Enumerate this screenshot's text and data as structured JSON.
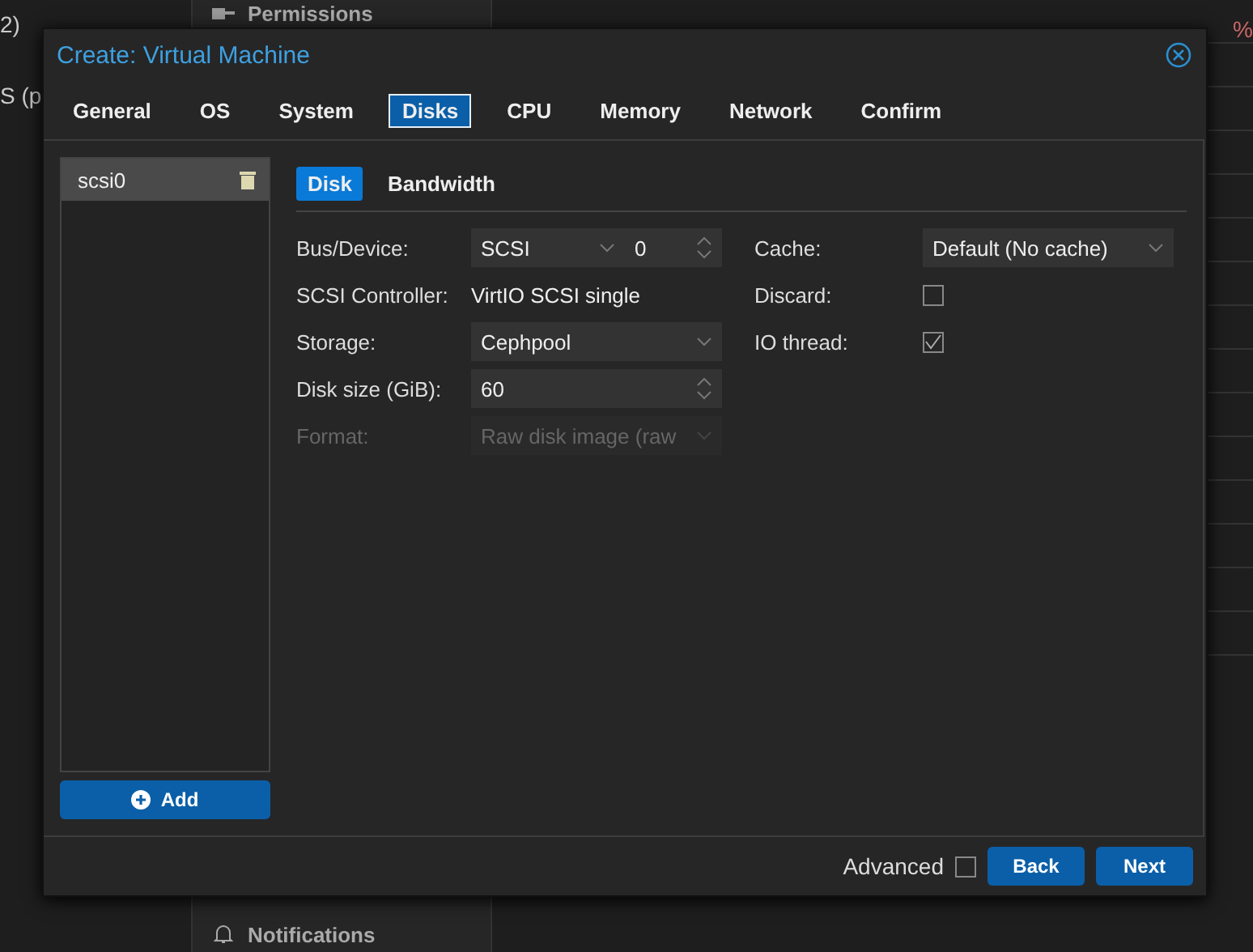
{
  "background": {
    "left_texts": [
      "2)",
      "S (p"
    ],
    "sidebar_items": [
      {
        "label": "Permissions"
      },
      {
        "label": "Notifications"
      }
    ],
    "edge_text": "%"
  },
  "dialog": {
    "title": "Create: Virtual Machine",
    "tabs": [
      {
        "label": "General",
        "selected": false
      },
      {
        "label": "OS",
        "selected": false
      },
      {
        "label": "System",
        "selected": false
      },
      {
        "label": "Disks",
        "selected": true
      },
      {
        "label": "CPU",
        "selected": false
      },
      {
        "label": "Memory",
        "selected": false
      },
      {
        "label": "Network",
        "selected": false
      },
      {
        "label": "Confirm",
        "selected": false
      }
    ],
    "disk_list": [
      {
        "label": "scsi0",
        "selected": true
      }
    ],
    "add_button": "Add",
    "subtabs": [
      {
        "label": "Disk",
        "selected": true
      },
      {
        "label": "Bandwidth",
        "selected": false
      }
    ],
    "left_fields": [
      {
        "label": "Bus/Device:",
        "kind": "bus",
        "value": "SCSI",
        "number": "0",
        "disabled": false
      },
      {
        "label": "SCSI Controller:",
        "kind": "text",
        "value": "VirtIO SCSI single",
        "disabled": false
      },
      {
        "label": "Storage:",
        "kind": "select",
        "value": "Cephpool",
        "disabled": false
      },
      {
        "label": "Disk size (GiB):",
        "kind": "spinner",
        "value": "60",
        "disabled": false
      },
      {
        "label": "Format:",
        "kind": "select",
        "value": "Raw disk image (raw",
        "disabled": true
      }
    ],
    "right_fields": [
      {
        "label": "Cache:",
        "kind": "select",
        "value": "Default (No cache)"
      },
      {
        "label": "Discard:",
        "kind": "checkbox",
        "checked": false
      },
      {
        "label": "IO thread:",
        "kind": "checkbox",
        "checked": true
      }
    ],
    "footer": {
      "advanced_label": "Advanced",
      "advanced_checked": false,
      "buttons": [
        "Back",
        "Next"
      ]
    }
  }
}
